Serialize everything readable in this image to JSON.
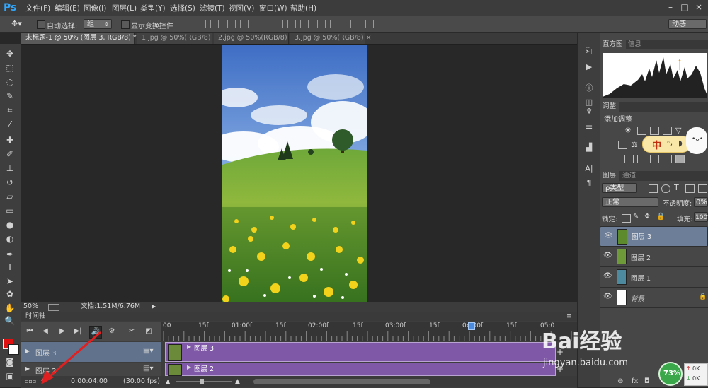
{
  "app": {
    "logo": "Ps"
  },
  "menu": [
    "文件(F)",
    "编辑(E)",
    "图像(I)",
    "图层(L)",
    "类型(Y)",
    "选择(S)",
    "滤镜(T)",
    "视图(V)",
    "窗口(W)",
    "帮助(H)"
  ],
  "window_controls": {
    "minimize": "–",
    "restore": "□",
    "close": "×"
  },
  "options": {
    "auto_select_label": "自动选择:",
    "auto_select_value": "组",
    "show_transform_label": "显示变换控件",
    "workspace": "动感"
  },
  "tabs": [
    {
      "label": "未标题-1 @ 50% (图层 3, RGB/8) *",
      "close": "×"
    },
    {
      "label": "1.jpg @ 50%(RGB/8)",
      "close": "×"
    },
    {
      "label": "2.jpg @ 50%(RGB/8)",
      "close": "×"
    },
    {
      "label": "3.jpg @ 50%(RGB/8)",
      "close": "×"
    }
  ],
  "status": {
    "zoom": "50%",
    "doc": "文档:1.51M/6.76M"
  },
  "timeline": {
    "title": "时间轴",
    "ticks": [
      "00",
      "15f",
      "01:00f",
      "15f",
      "02:00f",
      "15f",
      "03:00f",
      "15f",
      "04:00f",
      "15f",
      "05:0"
    ],
    "playhead_frame_fraction": 0.737,
    "tracks": [
      {
        "label": "图层 3",
        "bar_label": "图层 3"
      },
      {
        "label": "图层 2",
        "bar_label": "图层 2"
      }
    ],
    "time": "0:00:04:00",
    "fps": "(30.00 fps)"
  },
  "panels": {
    "histogram_tab": "直方图",
    "info_tab": "信息",
    "adjust_tab": "调整",
    "adjust_title": "添加调整",
    "layers_tab": "图层",
    "channels_tab": "通道",
    "filter_kind": "ρ类型",
    "blend_mode": "正常",
    "opacity_label": "不透明度:",
    "opacity_value": "0%",
    "lock_label": "锁定:",
    "fill_label": "填充:",
    "fill_value": "100%",
    "layers": [
      {
        "name": "图层 3",
        "selected": true
      },
      {
        "name": "图层 2",
        "selected": false
      },
      {
        "name": "图层 1",
        "selected": false
      },
      {
        "name": "背景",
        "selected": false
      }
    ]
  },
  "overlay": {
    "watermark_title": "Bai经验",
    "watermark_url": "jingyan.baidu.com",
    "ime": "中",
    "progress_percent": "73%",
    "net_up": "0K",
    "net_down": "0K"
  },
  "colors": {
    "accent": "#31a8ff",
    "track": "#7f58a8",
    "selected_layer": "#6c7e98",
    "playhead": "#d42b2b",
    "arrow": "#e02020"
  }
}
